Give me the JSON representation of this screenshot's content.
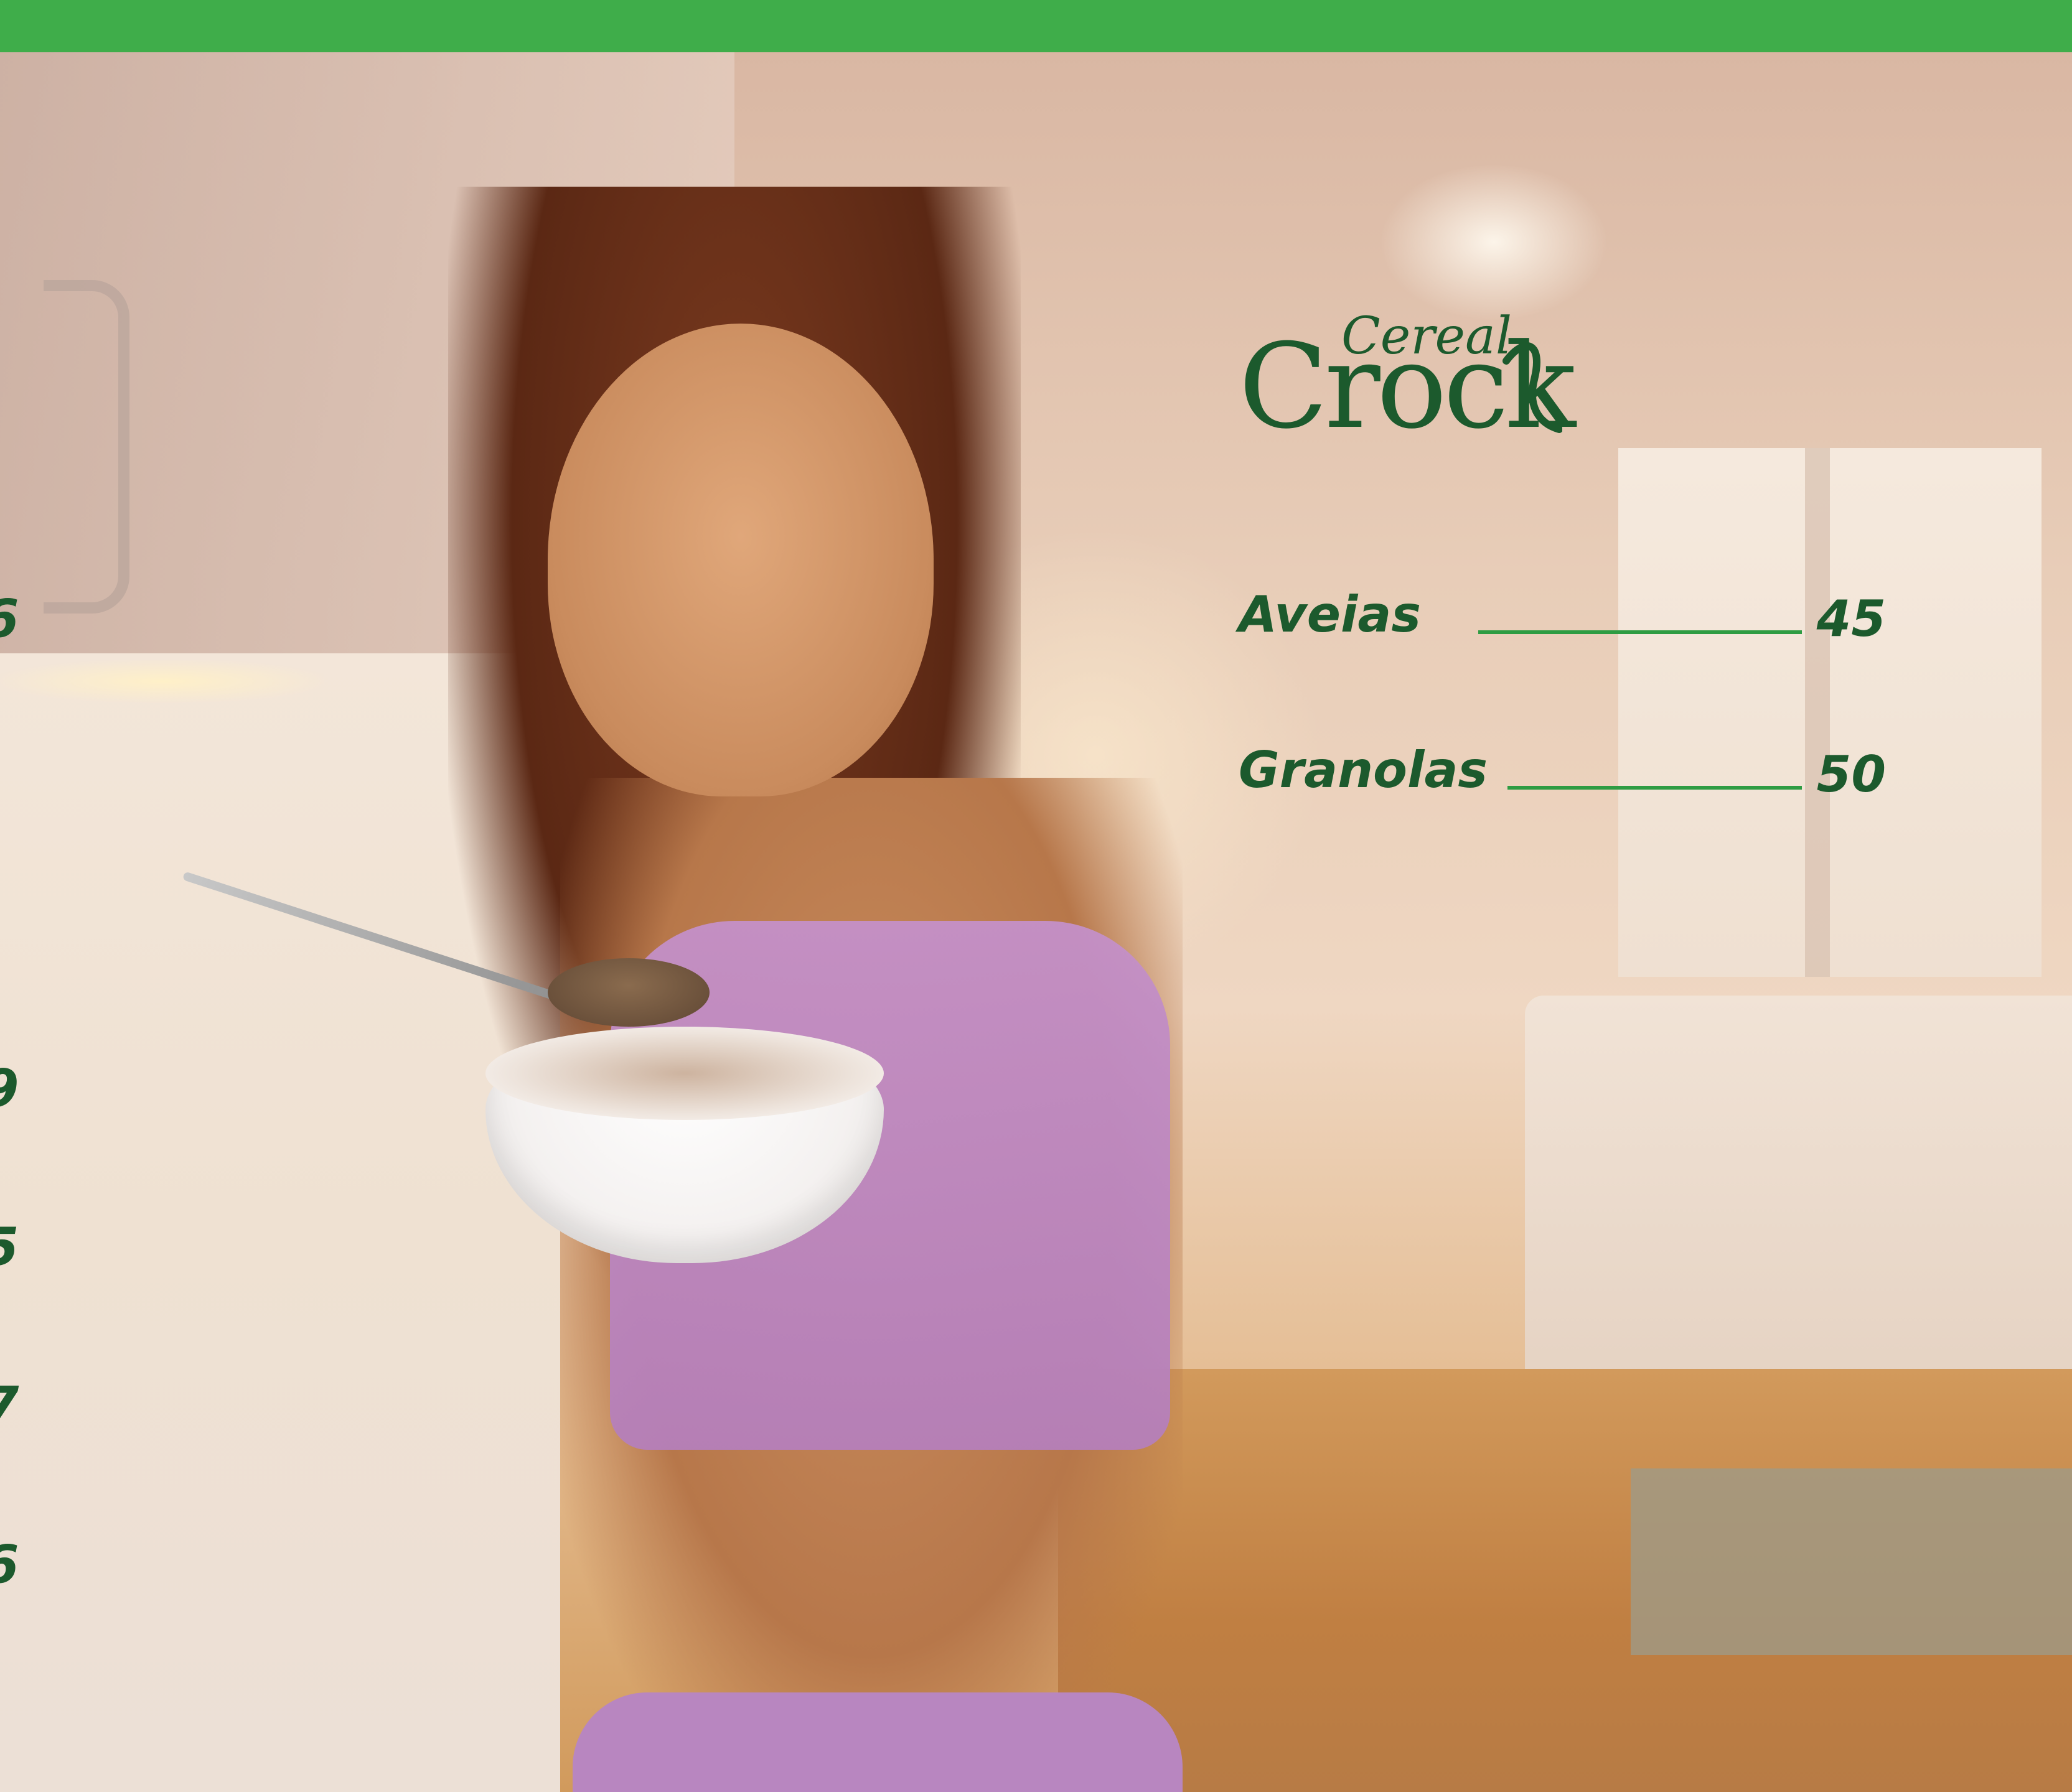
{
  "brand": {
    "logo_line1": "Cereal",
    "logo_line2": "Crock",
    "accent_color": "#3fad4a",
    "text_color": "#1c5a2d"
  },
  "toc": {
    "items": [
      {
        "label": "Aveias",
        "page": "45"
      },
      {
        "label": "Granolas",
        "page": "50"
      }
    ]
  },
  "cropped_left_page_numbers": [
    "6",
    "9",
    "5",
    "7",
    "6"
  ]
}
